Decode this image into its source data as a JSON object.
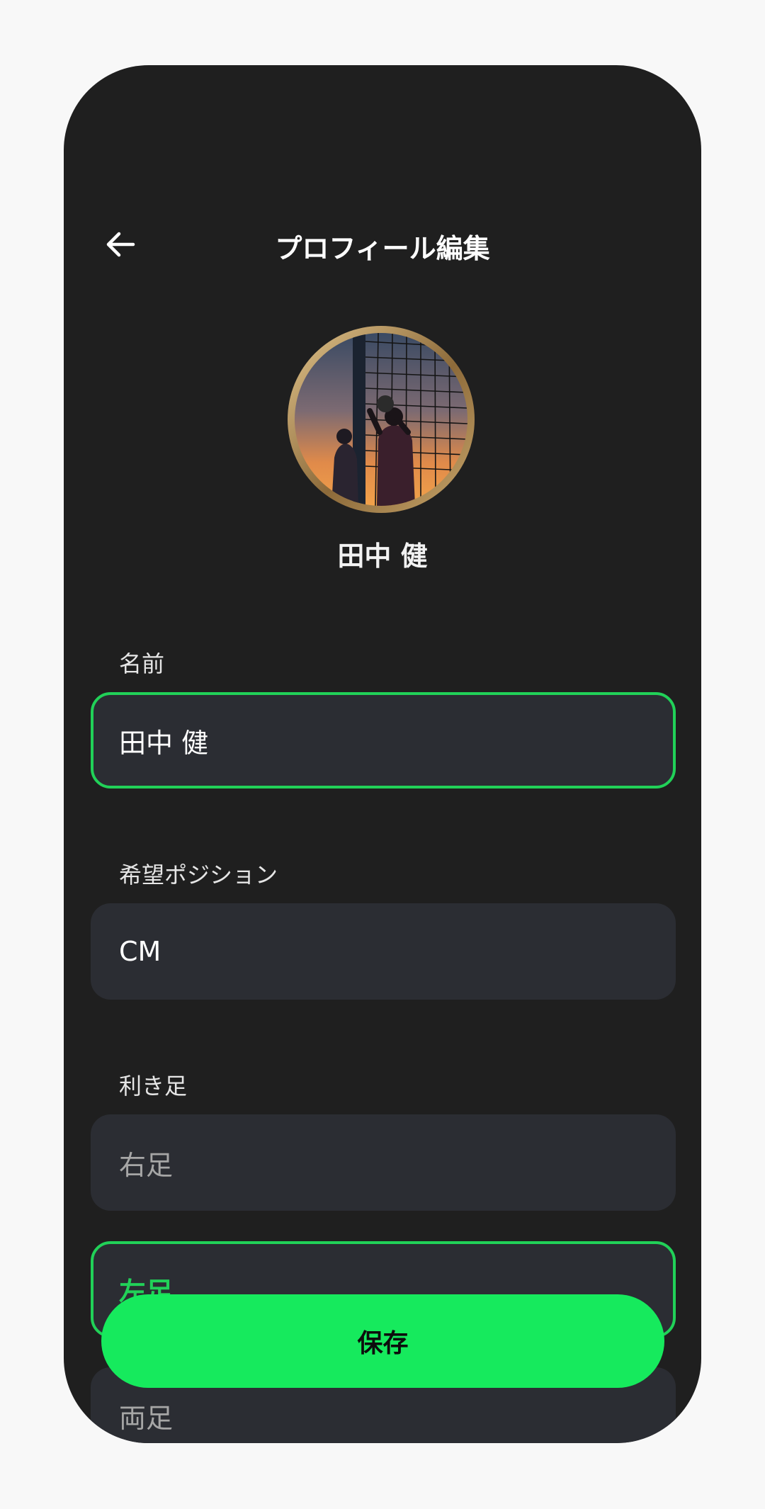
{
  "header": {
    "title": "プロフィール編集",
    "back_icon": "arrow-left-icon"
  },
  "profile": {
    "avatar_description": "goalkeeper-at-sunset-photo",
    "display_name": "田中 健"
  },
  "form": {
    "name_label": "名前",
    "name_value": "田中 健",
    "position_label": "希望ポジション",
    "position_value": "CM",
    "foot_label": "利き足",
    "foot_options": [
      "右足",
      "左足",
      "両足"
    ],
    "foot_selected": "左足"
  },
  "actions": {
    "save_label": "保存"
  },
  "colors": {
    "accent": "#16ea5d",
    "background": "#1f1f1f",
    "field": "#2b2d33"
  }
}
